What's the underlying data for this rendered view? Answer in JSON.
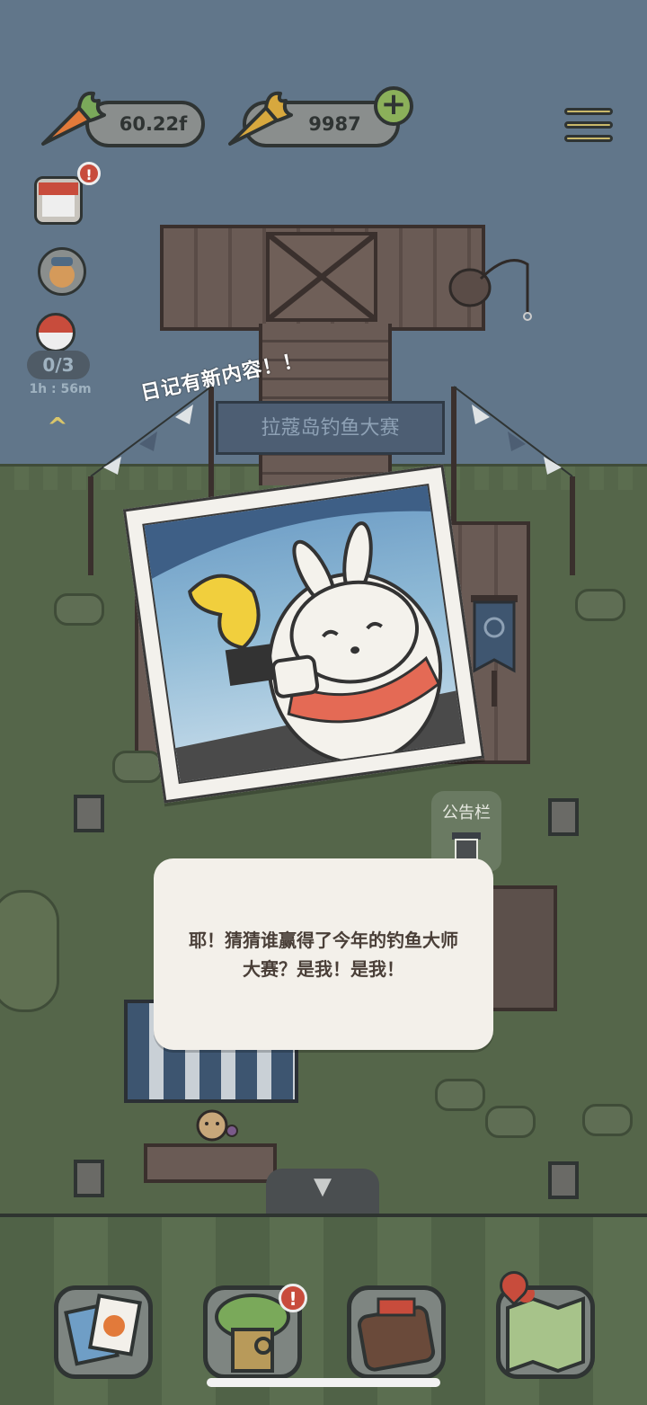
{
  "hud": {
    "currency_1": "60.22f",
    "currency_2": "9987",
    "add_symbol": "+",
    "bobber_count": "0/3",
    "timer": "1h : 56m",
    "collapse_up": "^",
    "alert_mark": "!"
  },
  "scene": {
    "new_content_text": "日记有新内容！！",
    "banner_text": "拉蔻岛钓鱼大赛",
    "notice_board_label": "公告栏"
  },
  "dialog": {
    "text": "耶！猜猜谁赢得了今年的钓鱼大师大赛？是我！是我！"
  },
  "colors": {
    "sky": "#61768a",
    "grass": "#55664a",
    "wood": "#6a5b55",
    "dialog_bg": "#f3f0ea",
    "accent_red": "#c84c3c",
    "accent_yellow": "#c9b86a"
  },
  "nav": {
    "items": [
      {
        "icon": "photo-album-icon"
      },
      {
        "icon": "tree-house-icon",
        "badge": "!"
      },
      {
        "icon": "backpack-icon"
      },
      {
        "icon": "map-icon"
      }
    ],
    "collapse_down": "▼"
  }
}
